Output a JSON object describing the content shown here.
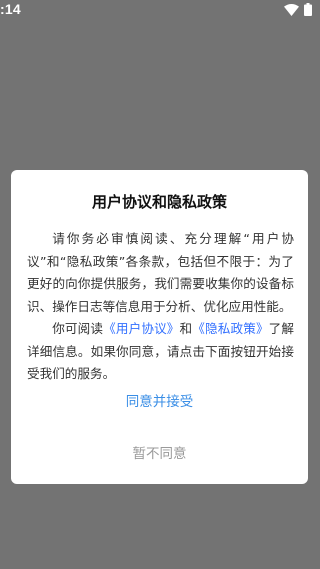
{
  "status_bar": {
    "time": ":14",
    "icons": [
      "wifi-icon",
      "battery-icon"
    ]
  },
  "dialog": {
    "title": "用户协议和隐私政策",
    "paragraph1": "请你务必审慎阅读、充分理解“用户协议”和“隐私政策”各条款，包括但不限于：为了更好的向你提供服务，我们需要收集你的设备标识、操作日志等信息用于分析、优化应用性能。",
    "paragraph2": {
      "prefix": "你可阅读",
      "link_user_agreement": "《用户协议》",
      "middle": "和",
      "link_privacy_policy": "《隐私政策》",
      "suffix": "了解详细信息。如果你同意，请点击下面按钮开始接受我们的服务。"
    },
    "accept_label": "同意并接受",
    "decline_label": "暂不同意"
  },
  "colors": {
    "backdrop": "#737373",
    "link": "#3370ff",
    "accept": "#3a8ee6",
    "decline": "#9a9a9a"
  }
}
